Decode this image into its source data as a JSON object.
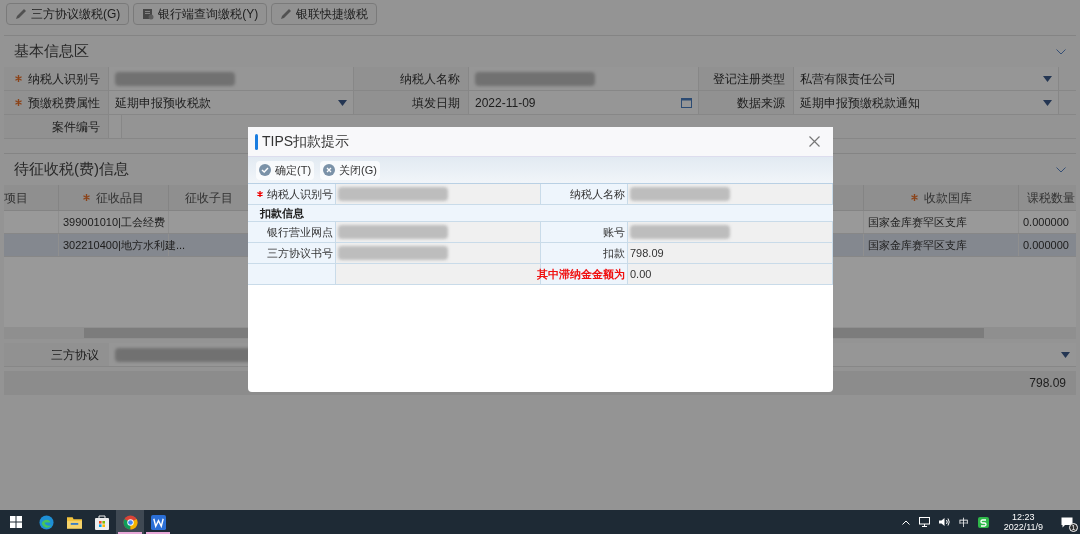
{
  "toolbar": {
    "buttons": [
      {
        "label": "三方协议缴税(G)",
        "kind": "pencil"
      },
      {
        "label": "银行端查询缴税(Y)",
        "kind": "bank"
      },
      {
        "label": "银联快捷缴税",
        "kind": "pencil"
      }
    ]
  },
  "basic_info": {
    "title": "基本信息区",
    "rows": [
      [
        {
          "label": "纳税人识别号",
          "required": true,
          "redacted": true,
          "kind": "text"
        },
        {
          "label": "纳税人名称",
          "required": false,
          "redacted": true,
          "kind": "text"
        },
        {
          "label": "登记注册类型",
          "required": false,
          "value": "私营有限责任公司",
          "kind": "dropdown"
        }
      ],
      [
        {
          "label": "预缴税费属性",
          "required": true,
          "value": "延期申报预收税款",
          "kind": "dropdown"
        },
        {
          "label": "填发日期",
          "required": false,
          "value": "2022-11-09",
          "kind": "date"
        },
        {
          "label": "数据来源",
          "required": false,
          "value": "延期申报预缴税款通知",
          "kind": "dropdown"
        }
      ],
      [
        {
          "label": "案件编号",
          "required": false,
          "kind": "text"
        }
      ]
    ]
  },
  "levy_info": {
    "title": "待征收税(费)信息",
    "columns": [
      {
        "label": "项目",
        "required": false
      },
      {
        "label": "征收品目",
        "required": true
      },
      {
        "label": "征收子目",
        "required": false
      },
      {
        "label": "收款国库",
        "required": true
      },
      {
        "label": "课税数量",
        "required": false
      }
    ],
    "rows": [
      {
        "selected": false,
        "cells": [
          "",
          "399001010|工会经费",
          "",
          "国家金库赛罕区支库",
          "0.000000"
        ]
      },
      {
        "selected": true,
        "cells": [
          "",
          "302210400|地方水利建...",
          "",
          "国家金库赛罕区支库",
          "0.000000"
        ]
      }
    ],
    "agreement": {
      "label": "三方协议",
      "redacted": true
    },
    "total": "798.09"
  },
  "dialog": {
    "title": "TIPS扣款提示",
    "buttons": [
      {
        "label": "确定(T)",
        "kind": "confirm"
      },
      {
        "label": "关闭(G)",
        "kind": "close"
      }
    ],
    "rows": [
      {
        "kind": "fields",
        "fields": [
          {
            "label": "纳税人识别号",
            "required": true,
            "redacted": true
          },
          {
            "label": "纳税人名称",
            "required": false,
            "redacted": true
          }
        ]
      },
      {
        "kind": "section",
        "title": "扣款信息"
      },
      {
        "kind": "fields",
        "fields": [
          {
            "label": "银行营业网点",
            "required": false,
            "redacted": true
          },
          {
            "label": "账号",
            "required": false,
            "redacted": true
          }
        ]
      },
      {
        "kind": "fields",
        "fields": [
          {
            "label": "三方协议书号",
            "required": false,
            "redacted": true
          },
          {
            "label": "扣款",
            "required": false,
            "value": "798.09"
          }
        ]
      },
      {
        "kind": "fields",
        "fields": [
          {
            "required": false
          },
          {
            "label": "其中滞纳金金额为",
            "required": false,
            "emphasis": true,
            "value": "0.00"
          }
        ]
      }
    ]
  },
  "taskbar": {
    "apps": [
      {
        "kind": "edge",
        "selected": false,
        "running": false
      },
      {
        "kind": "folder",
        "selected": false,
        "running": false
      },
      {
        "kind": "store",
        "selected": false,
        "running": false
      },
      {
        "kind": "chrome",
        "selected": true,
        "running": true
      },
      {
        "kind": "writer",
        "selected": false,
        "running": true
      }
    ],
    "ime": "中",
    "time": "12:23",
    "date": "2022/11/9",
    "notifications": "1"
  }
}
